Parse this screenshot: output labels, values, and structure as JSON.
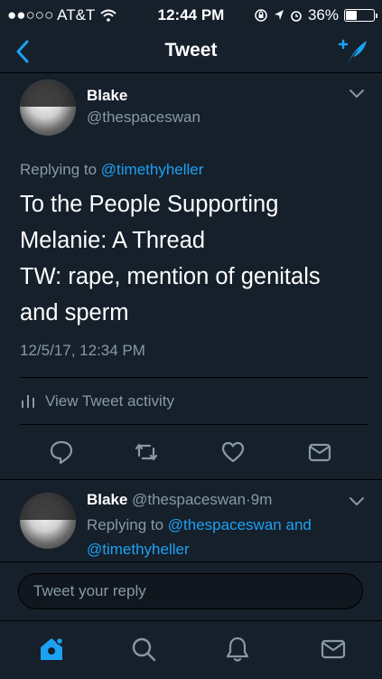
{
  "status_bar": {
    "carrier": "●●○○○ AT&T",
    "time": "12:44 PM",
    "battery_text": "36%",
    "battery_level": 0.36
  },
  "nav": {
    "title": "Tweet",
    "back_icon": "chevron-left-icon",
    "compose_icon": "compose-tweet-icon"
  },
  "tweet": {
    "author_name": "Blake",
    "author_handle": "@thespaceswan",
    "replying_to_prefix": "Replying to",
    "replying_to_handle": "@timethyheller",
    "text": "To the People Supporting\nMelanie: A Thread\nTW: rape, mention of genitals\nand sperm",
    "timestamp": "12/5/17, 12:34 PM",
    "activity_label": "View Tweet activity",
    "actions": [
      "reply-icon",
      "retweet-icon",
      "like-icon",
      "direct-message-icon"
    ]
  },
  "reply": {
    "author_name": "Blake",
    "author_handle": "@thespaceswan",
    "separator": "·",
    "age": "9m",
    "replying_to_prefix": "Replying to",
    "replying_to_handle1": "@thespaceswan",
    "conjunction": "and",
    "replying_to_handle2": "@timethyheller"
  },
  "composer": {
    "placeholder": "Tweet your reply"
  },
  "tab_bar": {
    "tabs": [
      "home-icon",
      "search-icon",
      "notifications-icon",
      "messages-icon"
    ],
    "active_tab": "home-icon"
  },
  "colors": {
    "background": "#15202b",
    "accent": "#1da1f2",
    "secondary_text": "#8899a6",
    "divider": "#000000"
  }
}
